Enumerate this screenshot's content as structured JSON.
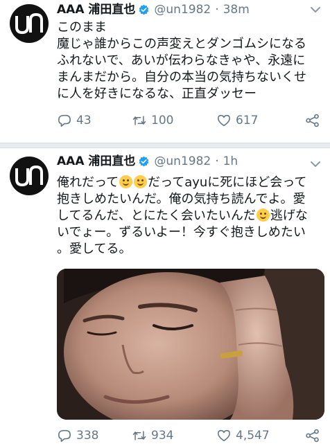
{
  "tweets": [
    {
      "avatar_text": "un",
      "name": "AAA 浦田直也",
      "handle": "@un1982",
      "separator": "·",
      "time": "38m",
      "lines": [
        "このまま",
        "魔じゃ誰からこの声変えとダンゴムシになる",
        "ふれないで、あいが伝わらなきゃや、永遠に",
        "まんまだから。自分の本当の気持ちないくせ",
        "に人を好きになるな、正直ダッセー"
      ],
      "replies": "43",
      "retweets": "100",
      "likes": "617"
    },
    {
      "avatar_text": "un",
      "name": "AAA 浦田直也",
      "handle": "@un1982",
      "separator": "·",
      "time": "1h",
      "line1_a": "俺れだって",
      "line1_b": "だってayuに死にほど会って",
      "line2": "抱きしめたいんだ。俺の気持ち読んでよ。愛",
      "line3_a": "してるんだ、とにたく会いたいんだ",
      "line3_b": "逃げな",
      "line4": "いでょー。ずるいよー！今すぐ抱きしめたい",
      "line5": "。愛してる。",
      "replies": "338",
      "retweets": "934",
      "likes": "4,547"
    }
  ],
  "icons": {
    "verified": "verified-badge-icon",
    "caret": "chevron-down-icon",
    "reply": "reply-icon",
    "retweet": "retweet-icon",
    "like": "heart-icon",
    "share": "share-icon"
  },
  "colors": {
    "verified": "#1da1f2",
    "secondary_text": "#657786",
    "divider": "#e6ecf0"
  }
}
